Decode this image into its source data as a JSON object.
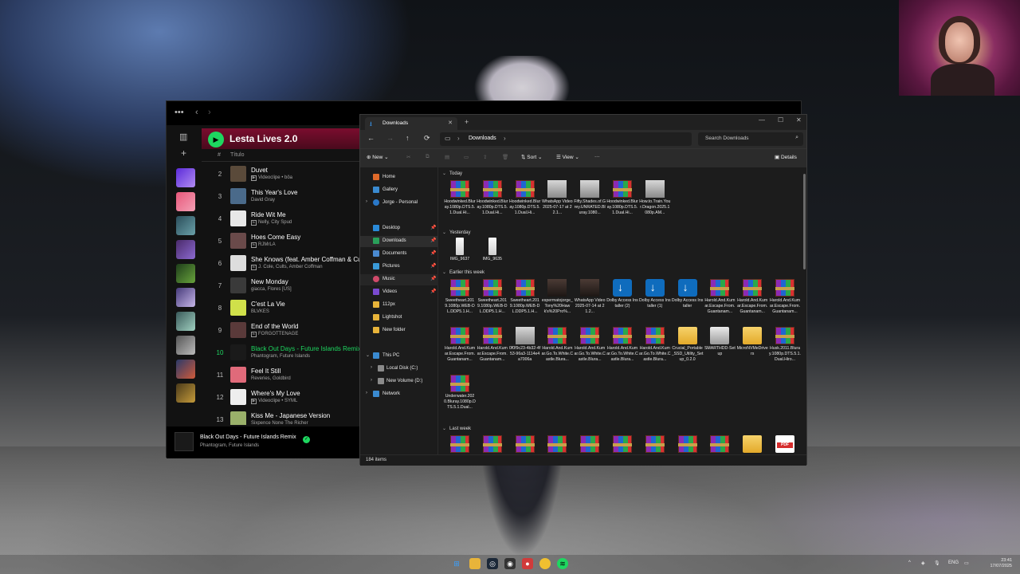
{
  "spotify": {
    "playlist_title": "Lesta Lives 2.0",
    "column_title": "Título",
    "tracks": [
      {
        "num": "2",
        "title": "Duvet",
        "artist": "Videoclipe • bôa",
        "badge": "▶"
      },
      {
        "num": "3",
        "title": "This Year's Love",
        "artist": "David Gray",
        "badge": ""
      },
      {
        "num": "4",
        "title": "Ride Wit Me",
        "artist": "Nelly, City Spud",
        "badge": "E"
      },
      {
        "num": "5",
        "title": "Hoes Come Easy",
        "artist": "RJMrLA",
        "badge": "E"
      },
      {
        "num": "6",
        "title": "She Knows (feat. Amber Coffman & Cu",
        "artist": "J. Cole, Cults, Amber Coffman",
        "badge": "E"
      },
      {
        "num": "7",
        "title": "New Monday",
        "artist": "giacca, Flores [US]",
        "badge": ""
      },
      {
        "num": "8",
        "title": "C'est La Vie",
        "artist": "BLVKES",
        "badge": ""
      },
      {
        "num": "9",
        "title": "End of the World",
        "artist": "FORGOTTENAGE",
        "badge": "E"
      },
      {
        "num": "10",
        "title": "Black Out Days - Future Islands Remix",
        "artist": "Phantogram, Future Islands",
        "badge": ""
      },
      {
        "num": "11",
        "title": "Feel It Still",
        "artist": "Reveries, Goldbird",
        "badge": ""
      },
      {
        "num": "12",
        "title": "Where's My Love",
        "artist": "Videoclipe • SYML",
        "badge": "▶"
      },
      {
        "num": "13",
        "title": "Kiss Me - Japanese Version",
        "artist": "Sixpence None The Richer",
        "badge": ""
      }
    ],
    "now_playing": {
      "title": "Black Out Days - Future Islands Remix",
      "artist": "Phantogram, Future Islands"
    },
    "colors": {
      "accent": "#1ed760",
      "header": "#7a0d2e"
    }
  },
  "explorer": {
    "tab_label": "Downloads",
    "breadcrumb": "Downloads",
    "search_placeholder": "Search Downloads",
    "commands": {
      "new": "New",
      "sort": "Sort",
      "view": "View",
      "more": "···",
      "details": "Details"
    },
    "nav": {
      "home": "Home",
      "gallery": "Gallery",
      "jorge": "Jorge - Personal",
      "desktop": "Desktop",
      "downloads": "Downloads",
      "documents": "Documents",
      "pictures": "Pictures",
      "music": "Music",
      "videos": "Videos",
      "f112px": "112px",
      "lightshot": "Lightshot",
      "newfolder": "New folder",
      "thispc": "This PC",
      "localdisk": "Local Disk (C:)",
      "newvolume": "New Volume (D:)",
      "network": "Network"
    },
    "groups": {
      "today": "Today",
      "yesterday": "Yesterday",
      "earlier": "Earlier this week",
      "lastweek": "Last week"
    },
    "files_today": [
      {
        "name": "Hoodwinked.Bluray.1080p.DTS.5.1.Dual.Hi...",
        "type": "rar"
      },
      {
        "name": "Hoodwinked.Bluray.1080p.DTS.5.1.Dual.Hi...",
        "type": "rar"
      },
      {
        "name": "Hoodwinked.Bluray.1080p.DTS.5.1.Dual.Hi...",
        "type": "rar"
      },
      {
        "name": "WhatsApp Video 2025-07-17 at 22.1...",
        "type": "vid"
      },
      {
        "name": "Fifty.Shades.of.Grey.UNRATED.Bluray.1080...",
        "type": "vid"
      },
      {
        "name": "Hoodwinked.Bluray.1080p.DTS.5.1.Dual.Hi...",
        "type": "rar"
      },
      {
        "name": "How.to.Train.Your.Dragon.2025.1080p.AM...",
        "type": "vid"
      }
    ],
    "files_yesterday": [
      {
        "name": "IMG_9637",
        "type": "phone"
      },
      {
        "name": "IMG_9635",
        "type": "phone"
      }
    ],
    "files_earlier": [
      {
        "name": "Sweetheart.2019.1080p.WEB-DL.DDP5.1.H...",
        "type": "rar"
      },
      {
        "name": "Sweetheart.2019.1080p.WEB-DL.DDP5.1.H...",
        "type": "rar"
      },
      {
        "name": "Sweetheart.2019.1080p.WEB-DL.DDP5.1.H...",
        "type": "rar"
      },
      {
        "name": "espermatojorge_Tony%20Hawk's%20Pro%...",
        "type": "vid-dark"
      },
      {
        "name": "WhatsApp Video 2025-07-14 at 21.2...",
        "type": "vid-dark"
      },
      {
        "name": "Dolby Access Installer (2)",
        "type": "dl"
      },
      {
        "name": "Dolby Access Installer (1)",
        "type": "dl"
      },
      {
        "name": "Dolby Access Installer",
        "type": "dl"
      },
      {
        "name": "Harold.And.Kumar.Escape.From.Guantanam...",
        "type": "rar"
      },
      {
        "name": "Harold.And.Kumar.Escape.From.Guantanam...",
        "type": "rar"
      },
      {
        "name": "Harold.And.Kumar.Escape.From.Guantanam...",
        "type": "rar"
      },
      {
        "name": "Harold.And.Kumar.Escape.From.Guantanam...",
        "type": "rar"
      },
      {
        "name": "Harold.And.Kumar.Escape.From.Guantanam...",
        "type": "rar"
      },
      {
        "name": "0f0f9c23-4b32-4f53-96a3-1114e4a7006a",
        "type": "vid"
      },
      {
        "name": "Harold.And.Kumar.Go.To.White.Castle.Blura...",
        "type": "rar"
      },
      {
        "name": "Harold.And.Kumar.Go.To.White.Castle.Blura...",
        "type": "rar"
      },
      {
        "name": "Harold.And.Kumar.Go.To.White.Castle.Blura...",
        "type": "rar"
      },
      {
        "name": "Harold.And.Kumar.Go.To.White.Castle.Blura...",
        "type": "rar"
      },
      {
        "name": "Crucial_Portable_SSD_Utility_Setup_0.2.0",
        "type": "folder"
      },
      {
        "name": "SMARTHDD-Setup",
        "type": "exe"
      },
      {
        "name": "MicroNVMeDrivers",
        "type": "folder"
      },
      {
        "name": "Husk.2011.Bluray.1080p.DTS.5.1.Dual.Hiro...",
        "type": "rar"
      },
      {
        "name": "Underwater.2020.Bluray.1080p.DTS.5.1.Dual...",
        "type": "rar"
      }
    ],
    "files_lastweek_types": [
      "rar",
      "rar",
      "rar",
      "rar",
      "rar",
      "rar",
      "rar",
      "rar",
      "rar",
      "folder",
      "pdf"
    ],
    "status": "184 items"
  },
  "taskbar": {
    "lang": "ENG",
    "time": "23:41",
    "date": "17/07/2025"
  }
}
